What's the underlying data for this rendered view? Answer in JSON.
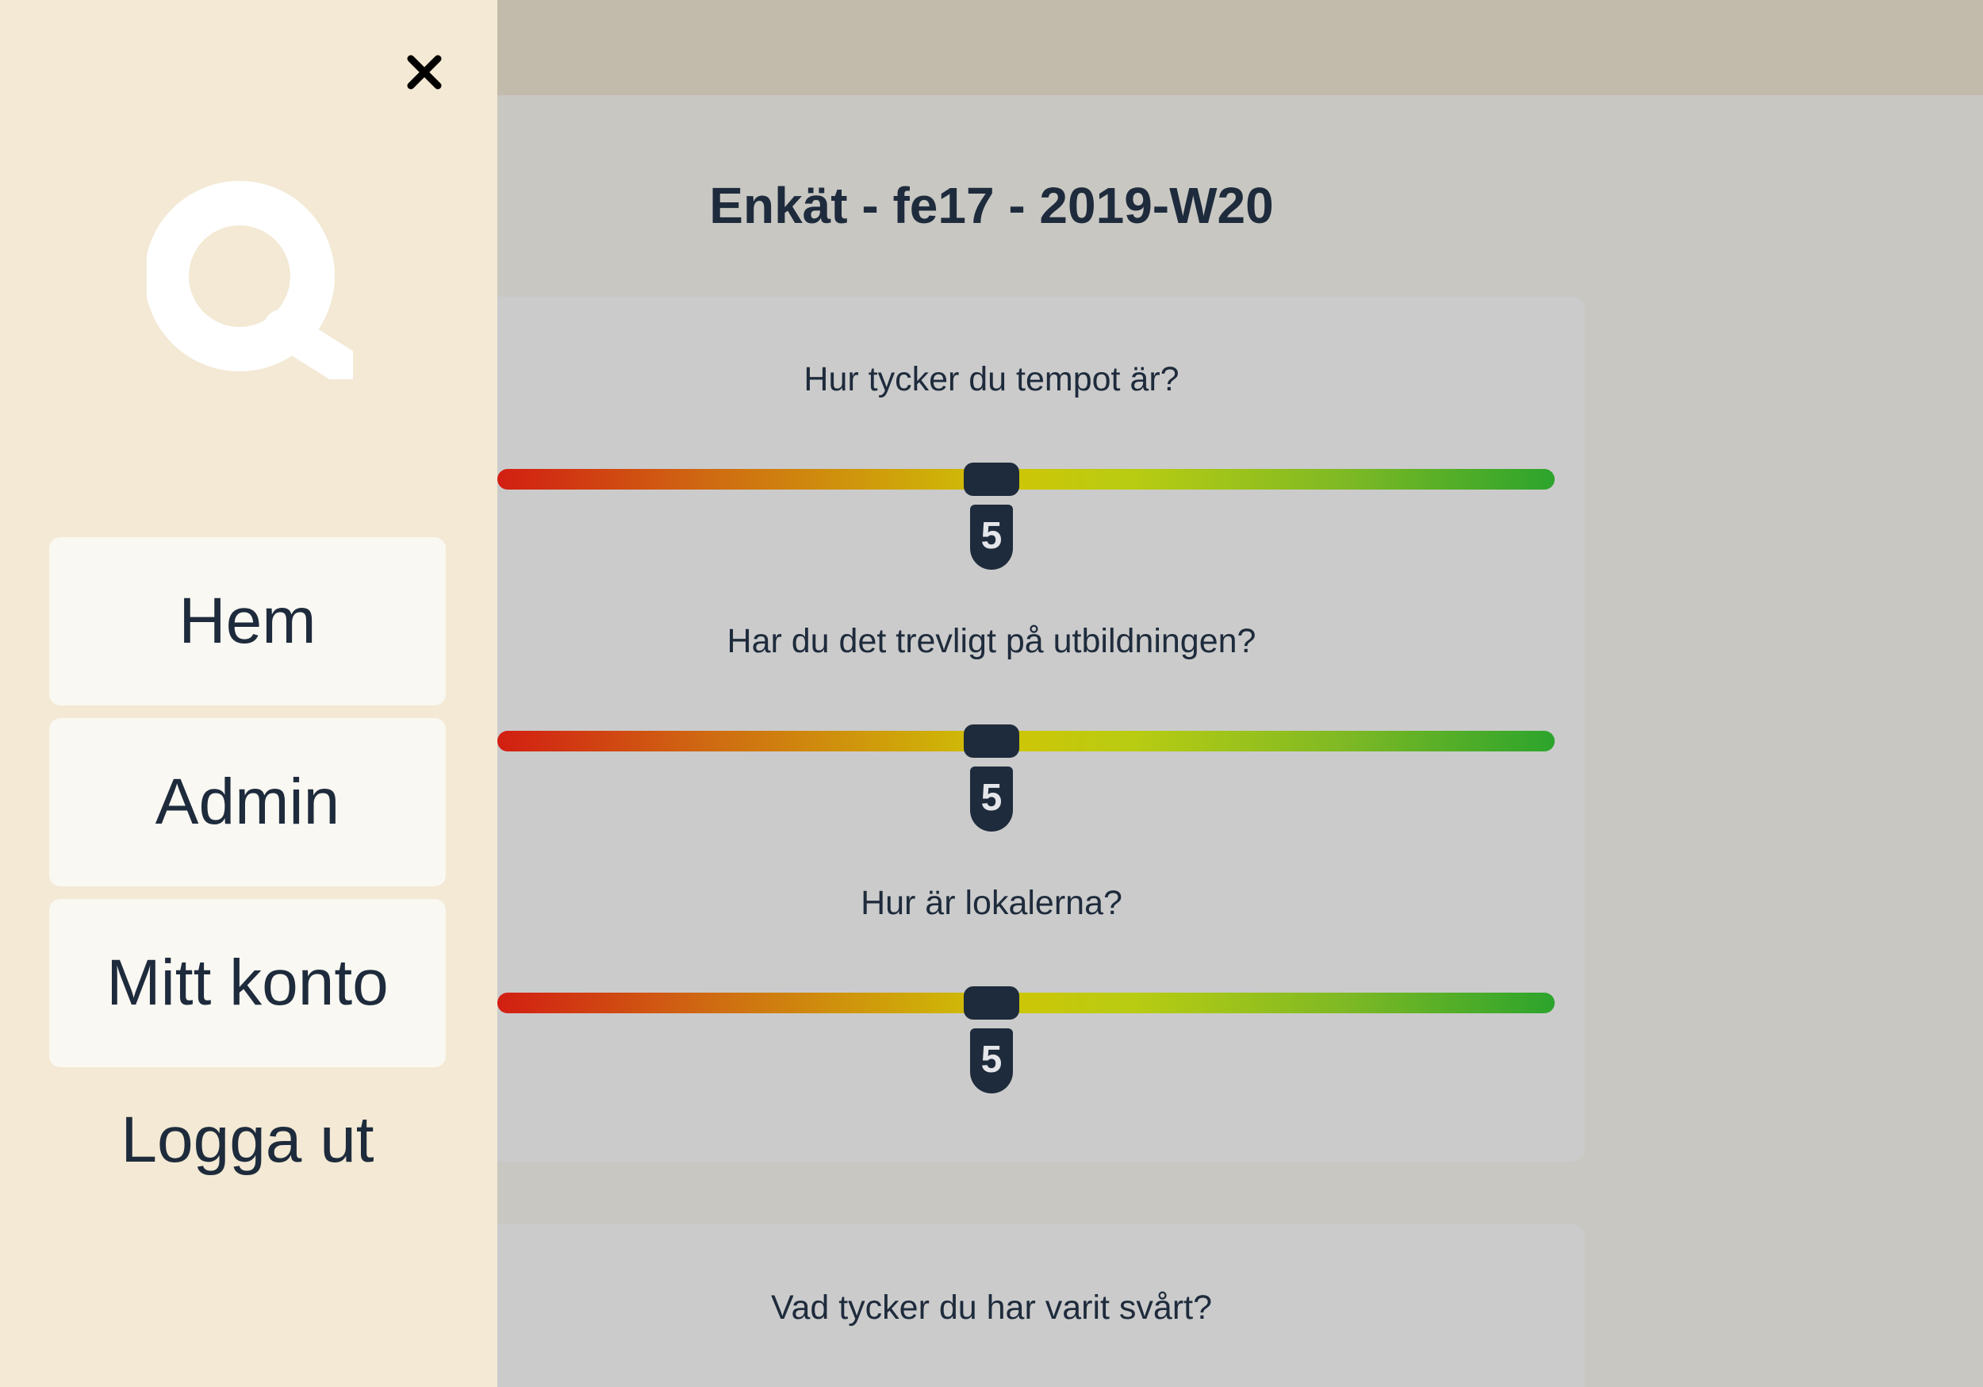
{
  "survey": {
    "title": "Enkät - fe17 - 2019-W20",
    "questions": [
      {
        "label": "Hur tycker du tempot är?",
        "value": "5",
        "min": 1,
        "max": 10,
        "level": 5
      },
      {
        "label": "Har du det trevligt på utbildningen?",
        "value": "5",
        "min": 1,
        "max": 10,
        "level": 5
      },
      {
        "label": "Hur är lokalerna?",
        "value": "5",
        "min": 1,
        "max": 10,
        "level": 5
      }
    ],
    "text_question": {
      "label": "Vad tycker du har varit svårt?"
    }
  },
  "menu": {
    "items": [
      {
        "label": "Hem"
      },
      {
        "label": "Admin"
      },
      {
        "label": "Mitt konto"
      }
    ],
    "logout_label": "Logga ut",
    "close_icon": "close-icon",
    "logo_icon": "q-logo"
  },
  "colors": {
    "menu_bg": "#f3e9d4",
    "menu_item_bg": "#faf8f2",
    "text": "#1e2b3c",
    "topbar": "#c2baab",
    "page_bg": "#c8c7c2",
    "card_bg": "#cbcbcb",
    "slider_start": "#d21e12",
    "slider_mid": "#cfc506",
    "slider_end": "#2ca42c"
  }
}
